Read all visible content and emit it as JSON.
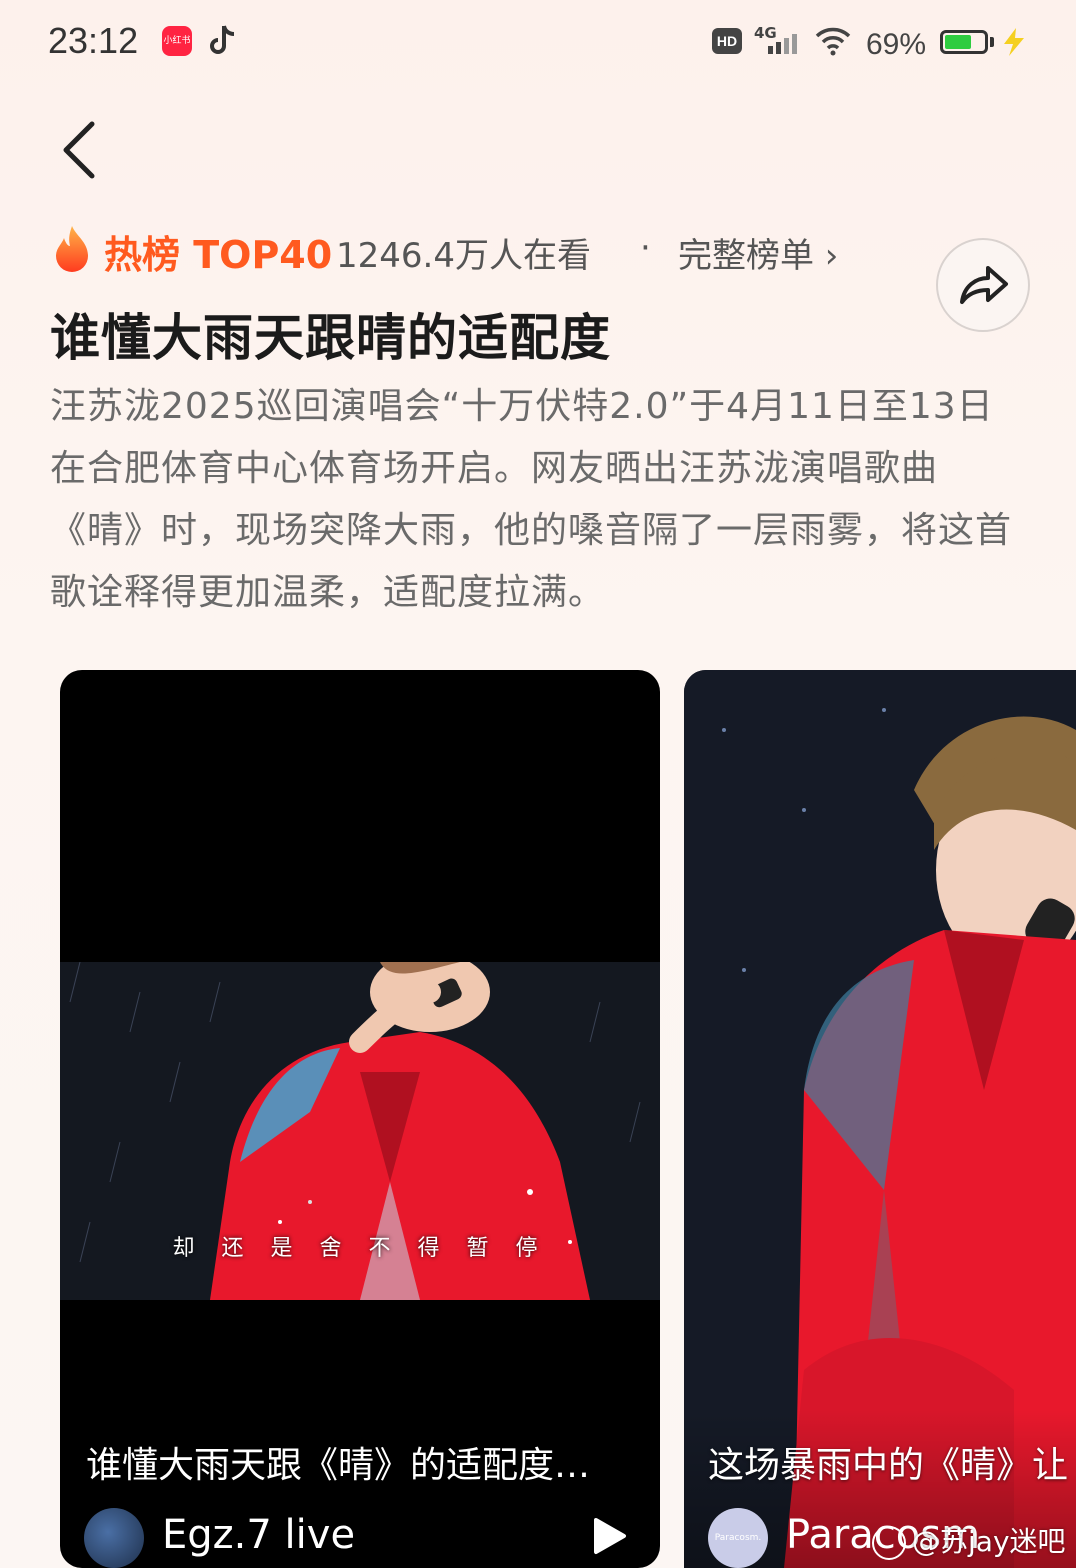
{
  "status_bar": {
    "time": "23:12",
    "hd": "HD",
    "network": "4G",
    "battery_percent": "69%",
    "battery_level": 0.69
  },
  "header": {
    "hot_label": "热榜 TOP40",
    "viewers": "1246.4万人在看",
    "separator": "·",
    "full_list": "完整榜单 ›"
  },
  "topic": {
    "title": "谁懂大雨天跟晴的适配度",
    "description": "汪苏泷2025巡回演唱会“十万伏特2.0”于4月11日至13日在合肥体育中心体育场开启。网友晒出汪苏泷演唱歌曲《晴》时，现场突降大雨，他的嗓音隔了一层雨雾，将这首歌诠释得更加温柔，适配度拉满。"
  },
  "cards": [
    {
      "subtitle": "却 还 是 舍 不 得 暂 停",
      "title": "谁懂大雨天跟《晴》的适配度…",
      "author": "Egz.7 live"
    },
    {
      "title": "这场暴雨中的《晴》让",
      "author": "Paracosm",
      "avatar_text": "Paracosm."
    }
  ],
  "watermark": "@苏jay迷吧",
  "colors": {
    "accent": "#ff5a1f",
    "card_bg": "#000000",
    "suit_red": "#e8182c"
  }
}
